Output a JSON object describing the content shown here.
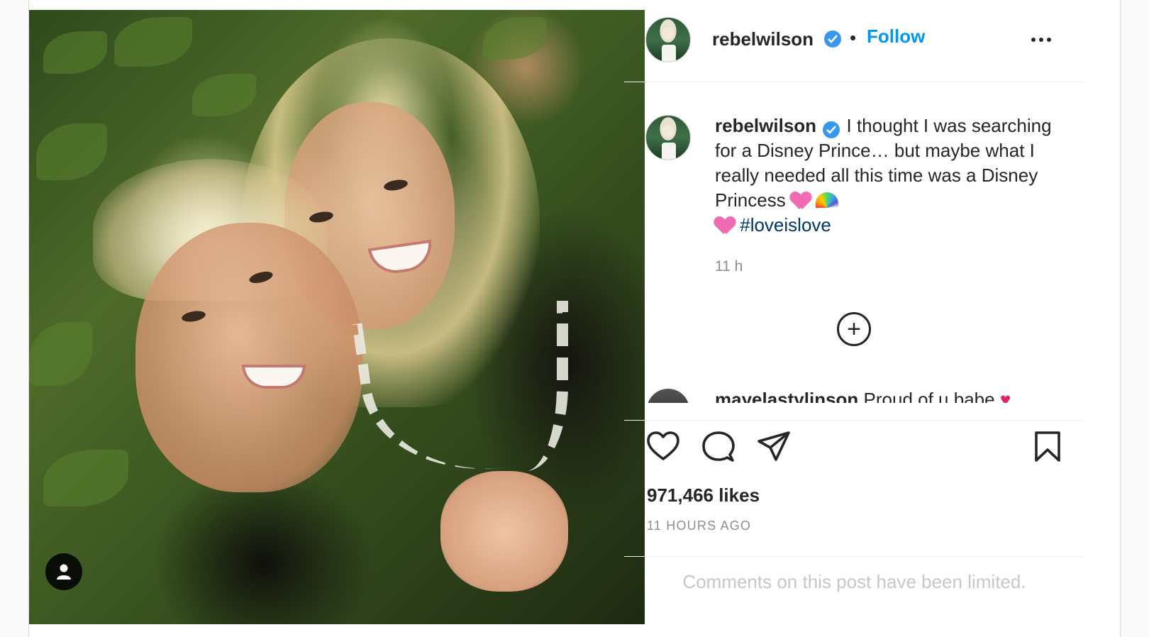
{
  "header": {
    "username": "rebelwilson",
    "separator": "•",
    "follow_label": "Follow"
  },
  "caption": {
    "username": "rebelwilson",
    "text": "I thought I was searching for a Disney Prince… but maybe what I really needed all this time was a Disney Princess",
    "hashtag": "#loveislove",
    "emojis": [
      "pink-heart",
      "rainbow",
      "pink-heart"
    ],
    "time": "11 h"
  },
  "comment_preview": {
    "username": "mayelastylinson",
    "text": "Proud of u babe"
  },
  "actions": {
    "icons": [
      "heart-icon",
      "comment-icon",
      "share-icon",
      "bookmark-icon"
    ]
  },
  "stats": {
    "likes": "971,466 likes",
    "posted": "11 HOURS AGO"
  },
  "comments_notice": "Comments on this post have been limited.",
  "colors": {
    "link_blue": "#0095f6",
    "hashtag_blue": "#00376b",
    "verified_blue": "#3897f0",
    "muted_gray": "#8e8e8e"
  }
}
